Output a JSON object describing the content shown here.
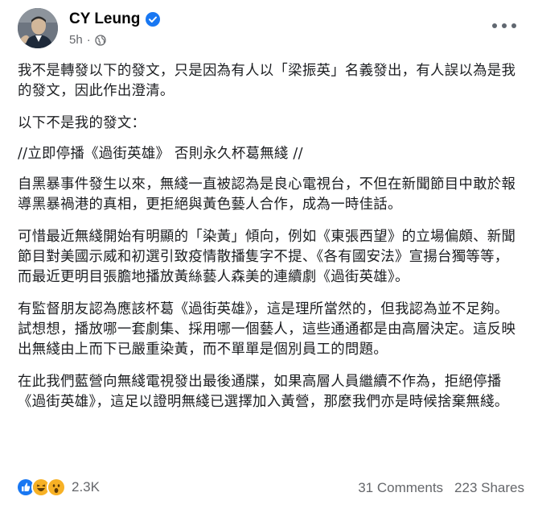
{
  "post": {
    "author": "CY Leung",
    "time": "5h",
    "separator": "·",
    "icons": {
      "verified": "verified-badge-icon",
      "audience": "globe-icon",
      "menu": "more-options-icon"
    },
    "paragraphs": [
      "我不是轉發以下的發文，只是因為有人以「梁振英」名義發出，有人誤以為是我的發文，因此作出澄清。",
      "以下不是我的發文：",
      "//立即停播《過街英雄》 否則永久杯葛無綫 //",
      "自黑暴事件發生以來，無綫一直被認為是良心電視台，不但在新聞節目中敢於報導黑暴禍港的真相，更拒絕與黃色藝人合作，成為一時佳話。",
      "可惜最近無綫開始有明顯的「染黃」傾向，例如《東張西望》的立場偏頗、新聞節目對美國示威和初選引致疫情散播隻字不提、《各有國安法》宣揚台獨等等，而最近更明目張膽地播放黃絲藝人森美的連續劇《過街英雄》。",
      "有監督朋友認為應該杯葛《過街英雄》，這是理所當然的，但我認為並不足夠。試想想，播放哪一套劇集、採用哪一個藝人，這些通通都是由高層決定。這反映出無綫由上而下已嚴重染黃，而不單單是個別員工的問題。",
      "在此我們藍營向無綫電視發出最後通牒，如果高層人員繼續不作為，拒絕停播《過街英雄》，這足以證明無綫已選擇加入黃營，那麼我們亦是時候捨棄無綫。"
    ]
  },
  "footer": {
    "reaction_icons": [
      "like-icon",
      "haha-icon",
      "wow-icon"
    ],
    "reaction_count": "2.3K",
    "comments": "31 Comments",
    "shares": "223 Shares"
  },
  "colors": {
    "accent": "#1877f2",
    "muted": "#65676b",
    "text": "#1c1e21"
  }
}
